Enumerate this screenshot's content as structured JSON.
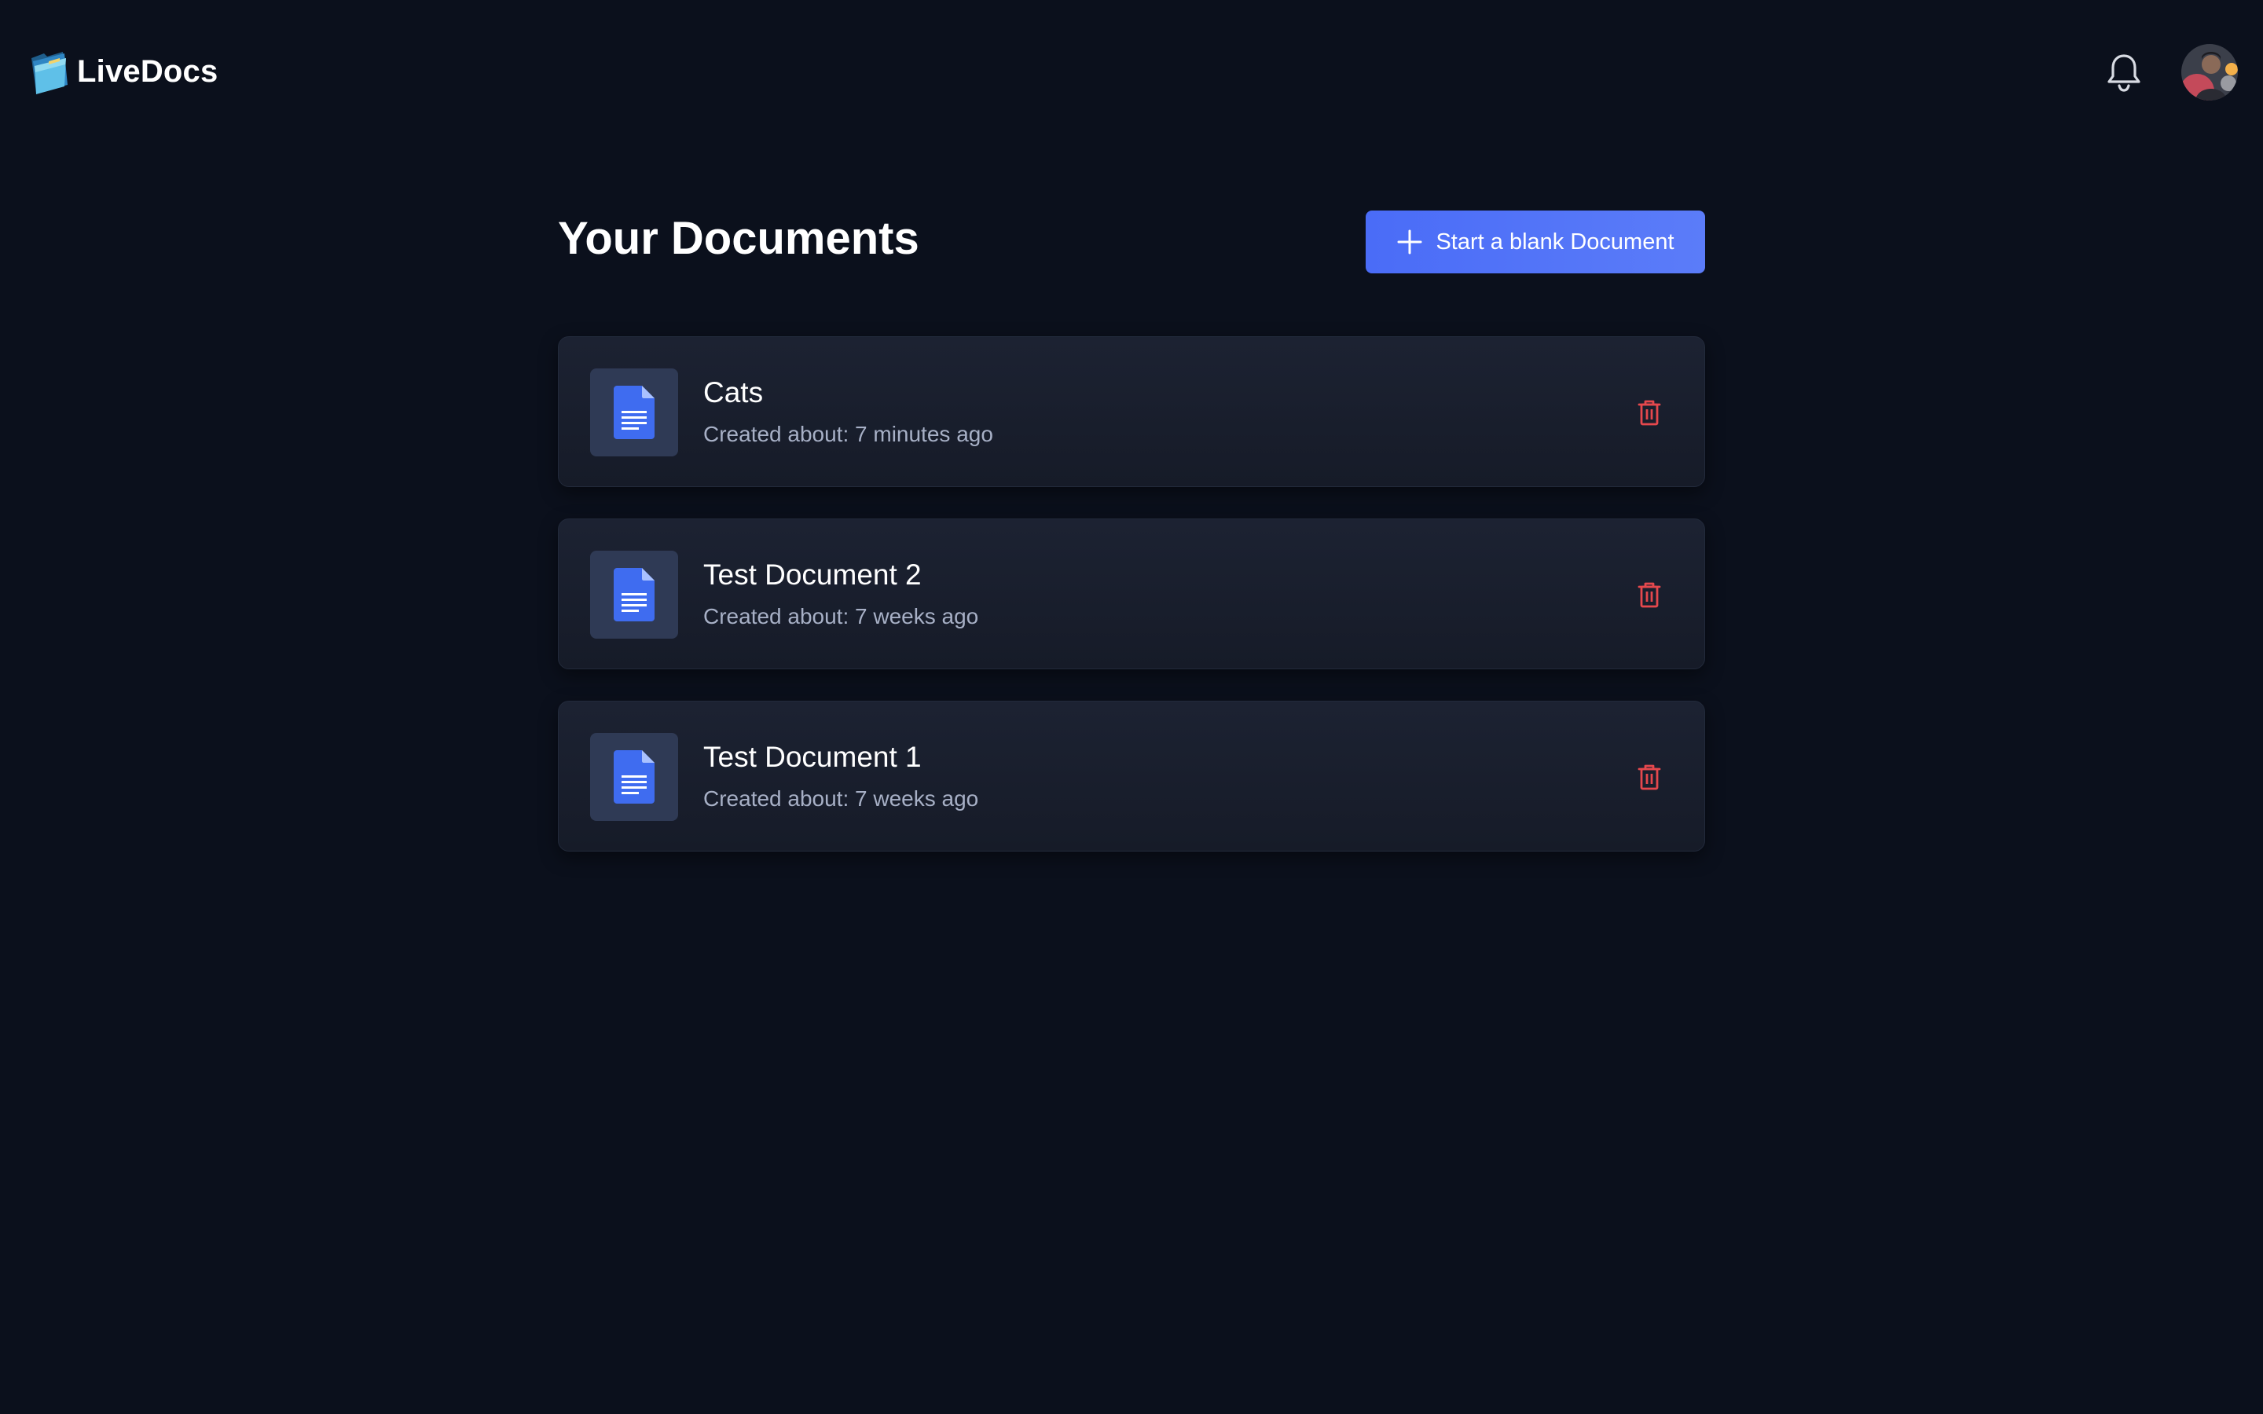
{
  "app": {
    "name": "LiveDocs"
  },
  "header": {
    "logo_icon": "folder-logo-icon",
    "notification_icon": "bell-icon",
    "avatar_icon": "user-avatar"
  },
  "main": {
    "title": "Your Documents",
    "new_button": {
      "label": "Start a blank Document",
      "icon": "plus-icon"
    },
    "documents": [
      {
        "title": "Cats",
        "meta": "Created about: 7 minutes ago"
      },
      {
        "title": "Test Document 2",
        "meta": "Created about: 7 weeks ago"
      },
      {
        "title": "Test Document 1",
        "meta": "Created about: 7 weeks ago"
      }
    ]
  },
  "colors": {
    "background": "#0b101c",
    "card": "#1a2030",
    "accent": "#4f6ef7",
    "doc_icon": "#3f6cf0",
    "delete": "#e5484d",
    "meta_text": "#a7b0c6"
  }
}
